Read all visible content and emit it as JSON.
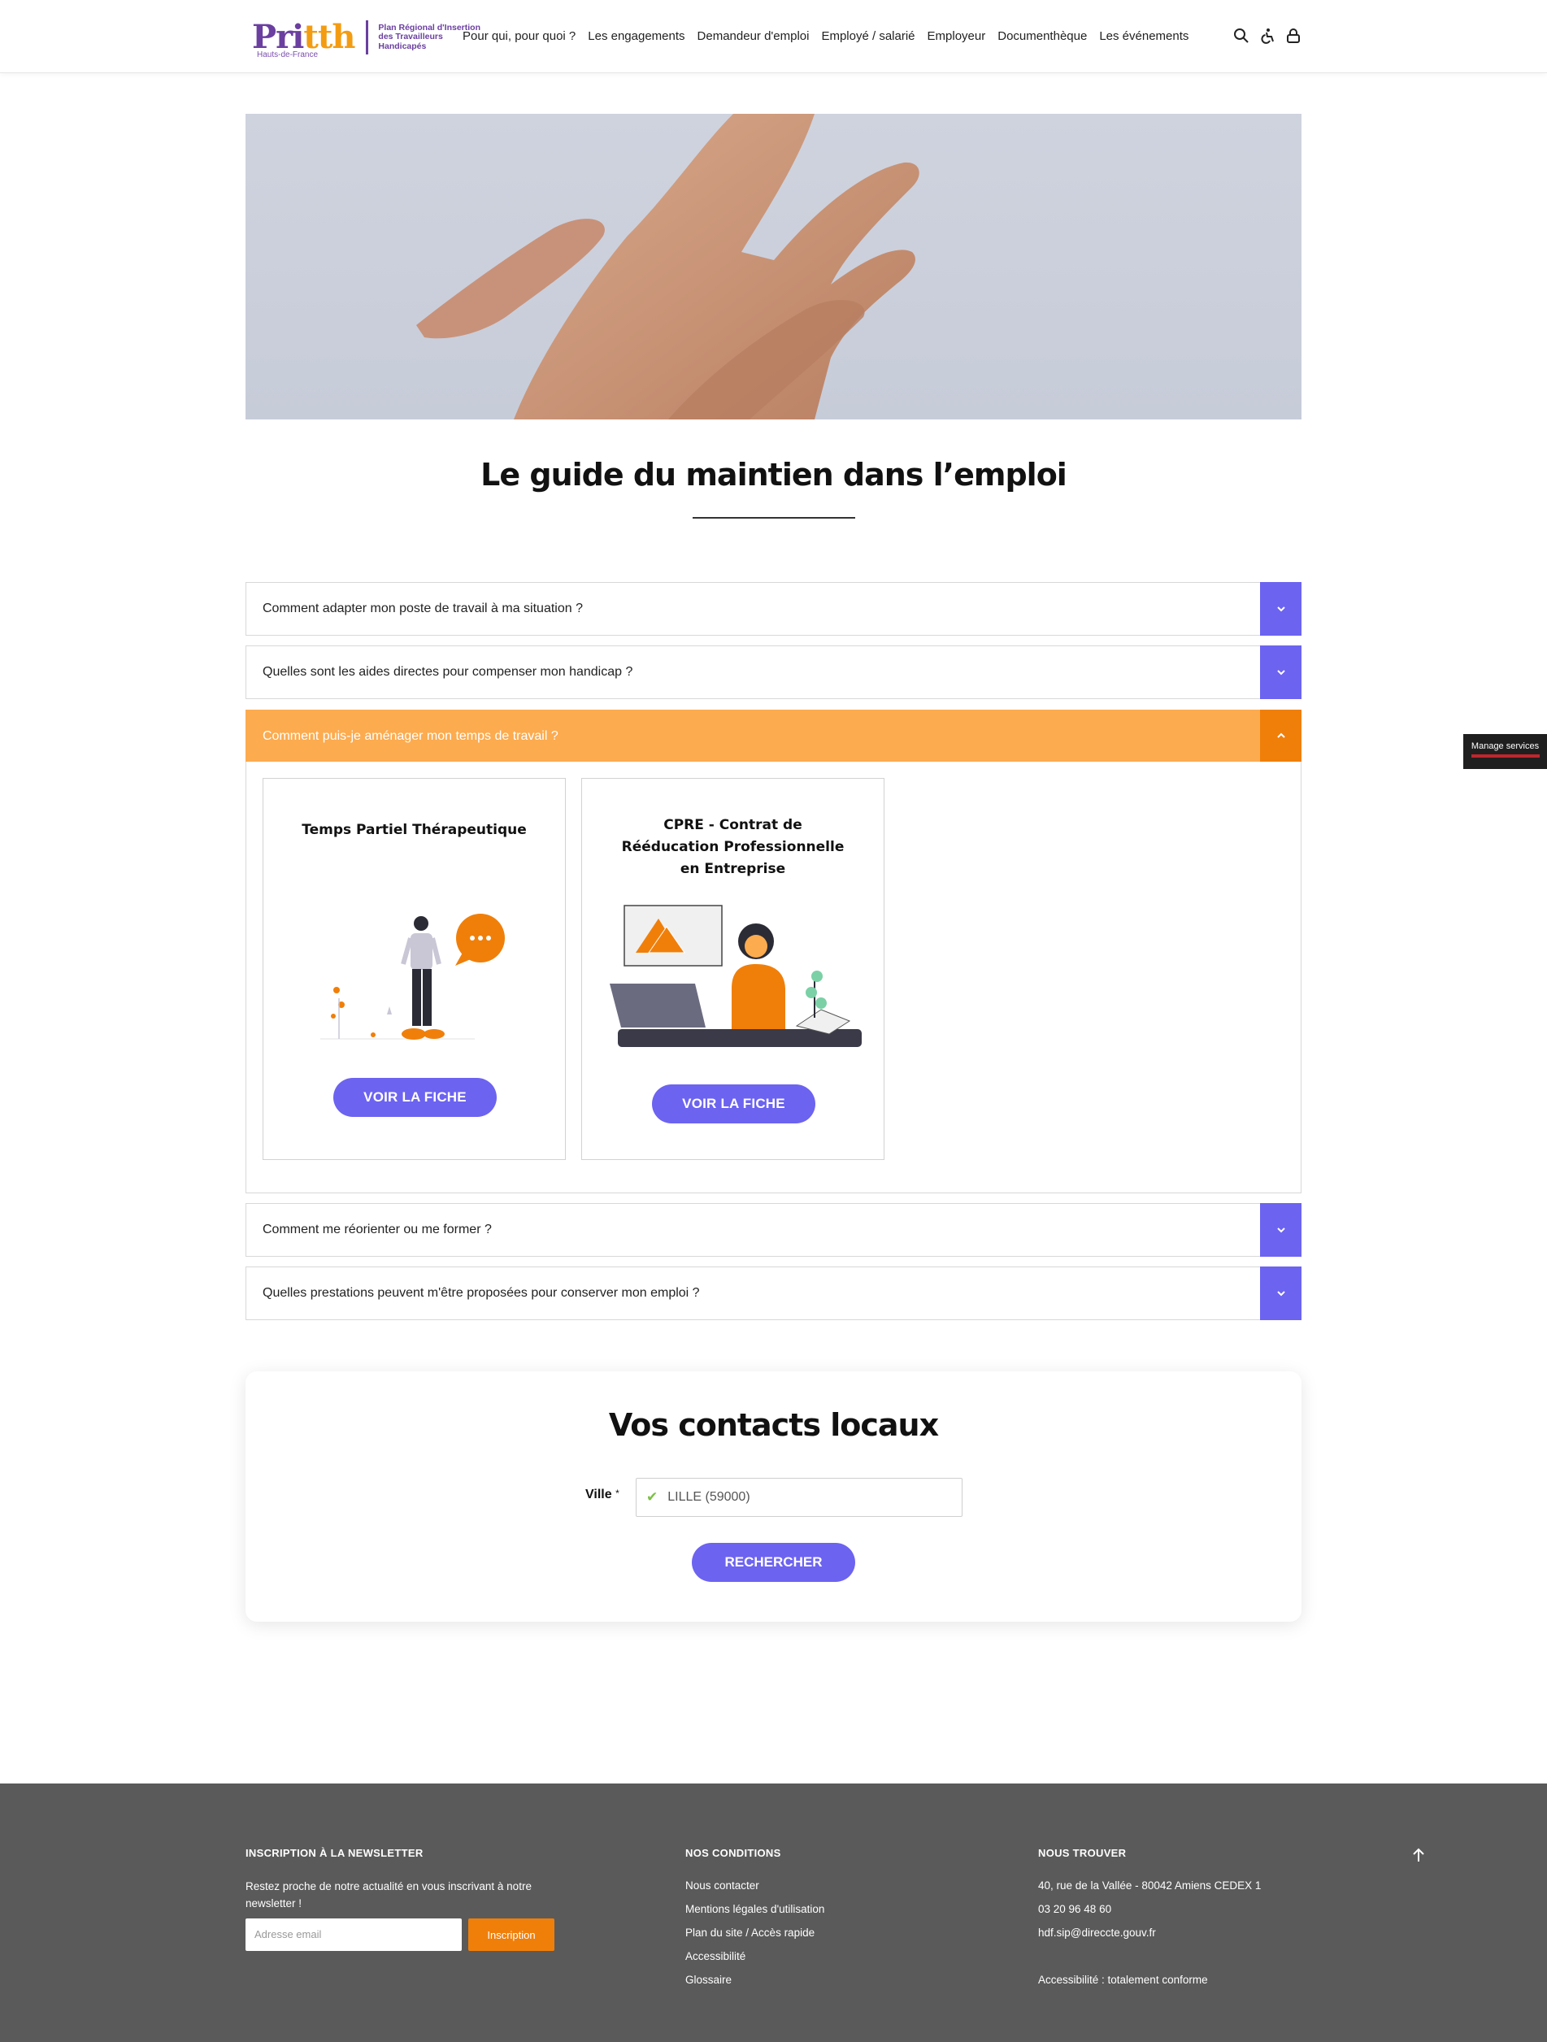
{
  "header": {
    "logo": {
      "word_main": "Pri",
      "word_accent": "tth",
      "sub": "Hauts-de-France",
      "text": "Plan Régional d'Insertion des Travailleurs Handicapés"
    },
    "nav": [
      "Pour qui, pour quoi ?",
      "Les engagements",
      "Demandeur d'emploi",
      "Employé / salarié",
      "Employeur",
      "Documenthèque",
      "Les événements"
    ],
    "icons": [
      "search-icon",
      "accessibility-icon",
      "lock-icon"
    ]
  },
  "page": {
    "title": "Le guide du maintien dans l’emploi"
  },
  "accordion": [
    {
      "label": "Comment adapter mon poste de travail à ma situation ?",
      "state": "closed",
      "icon": "chevron-down-icon"
    },
    {
      "label": "Quelles sont les aides directes pour compenser mon handicap ?",
      "state": "closed",
      "icon": "chevron-down-icon"
    },
    {
      "label": "Comment puis-je aménager mon temps de travail ?",
      "state": "open",
      "icon": "chevron-up-icon"
    },
    {
      "label": "Comment me réorienter ou me former ?",
      "state": "closed",
      "icon": "chevron-down-icon"
    },
    {
      "label": "Quelles prestations peuvent m'être proposées pour conserver mon emploi ?",
      "state": "closed",
      "icon": "chevron-down-icon"
    }
  ],
  "cards": [
    {
      "title": "Temps Partiel Thérapeutique",
      "button": "VOIR LA FICHE"
    },
    {
      "title_lines": [
        "CPRE - Contrat de",
        "Rééducation Professionnelle",
        "en Entreprise"
      ],
      "button": "VOIR LA FICHE"
    }
  ],
  "contacts": {
    "title": "Vos contacts locaux",
    "ville_label": "Ville",
    "required_mark": "*",
    "ville_value": "LILLE (59000)",
    "search_button": "RECHERCHER"
  },
  "side_tab": {
    "label": "Manage services"
  },
  "footer": {
    "newsletter": {
      "heading": "INSCRIPTION À LA NEWSLETTER",
      "text": "Restez proche de notre actualité en vous inscrivant à notre newsletter !",
      "email_placeholder": "Adresse email",
      "button": "Inscription"
    },
    "conditions": {
      "heading": "NOS CONDITIONS",
      "links": [
        "Nous contacter",
        "Mentions légales d'utilisation",
        "Plan du site / Accès rapide",
        "Accessibilité",
        "Glossaire"
      ]
    },
    "find_us": {
      "heading": "NOUS TROUVER",
      "address": "40, rue de la Vallée - 80042 Amiens CEDEX 1",
      "phone": "03 20 96 48 60",
      "email": "hdf.sip@direccte.gouv.fr",
      "accessibility": "Accessibilité : totalement conforme"
    }
  },
  "colors": {
    "purple_accent": "#6c63f0",
    "orange_open": "#fcab4f",
    "orange_dark": "#f07f0a",
    "footer_bg": "#5a5a5a"
  }
}
